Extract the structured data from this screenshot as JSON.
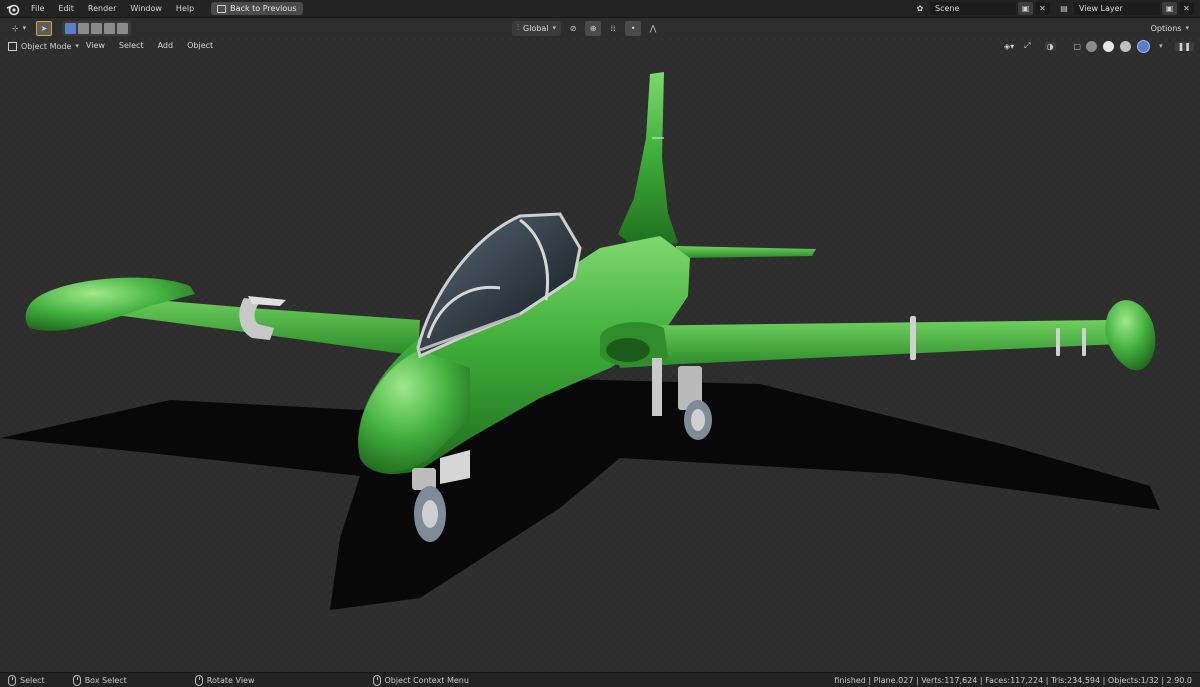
{
  "topbar": {
    "menus": [
      "File",
      "Edit",
      "Render",
      "Window",
      "Help"
    ],
    "back_button": "Back to Previous",
    "scene_label": "Scene",
    "view_layer_label": "View Layer"
  },
  "header": {
    "transform_orientation": "Global",
    "options_label": "Options"
  },
  "viewport_header": {
    "mode": "Object Mode",
    "menus": [
      "View",
      "Select",
      "Add",
      "Object"
    ]
  },
  "statusbar": {
    "select": "Select",
    "box_select": "Box Select",
    "rotate_view": "Rotate View",
    "context_menu": "Object Context Menu",
    "stats": "finished | Plane.027 | Verts:117,624 | Faces:117,224 | Tris:234,594 | Objects:1/32 | 2.90.0"
  },
  "colors": {
    "accent": "#5a7fc7",
    "jet_body": "#3fae3a",
    "jet_highlight": "#7fd86f",
    "jet_shadow": "#1f6b1d"
  },
  "icons": [
    "blender-logo",
    "cursor-icon",
    "select-box-icon",
    "transform-pivot-icon",
    "snap-icon",
    "proportional-icon",
    "scene-icon",
    "view-layer-icon",
    "mouse-icon"
  ]
}
